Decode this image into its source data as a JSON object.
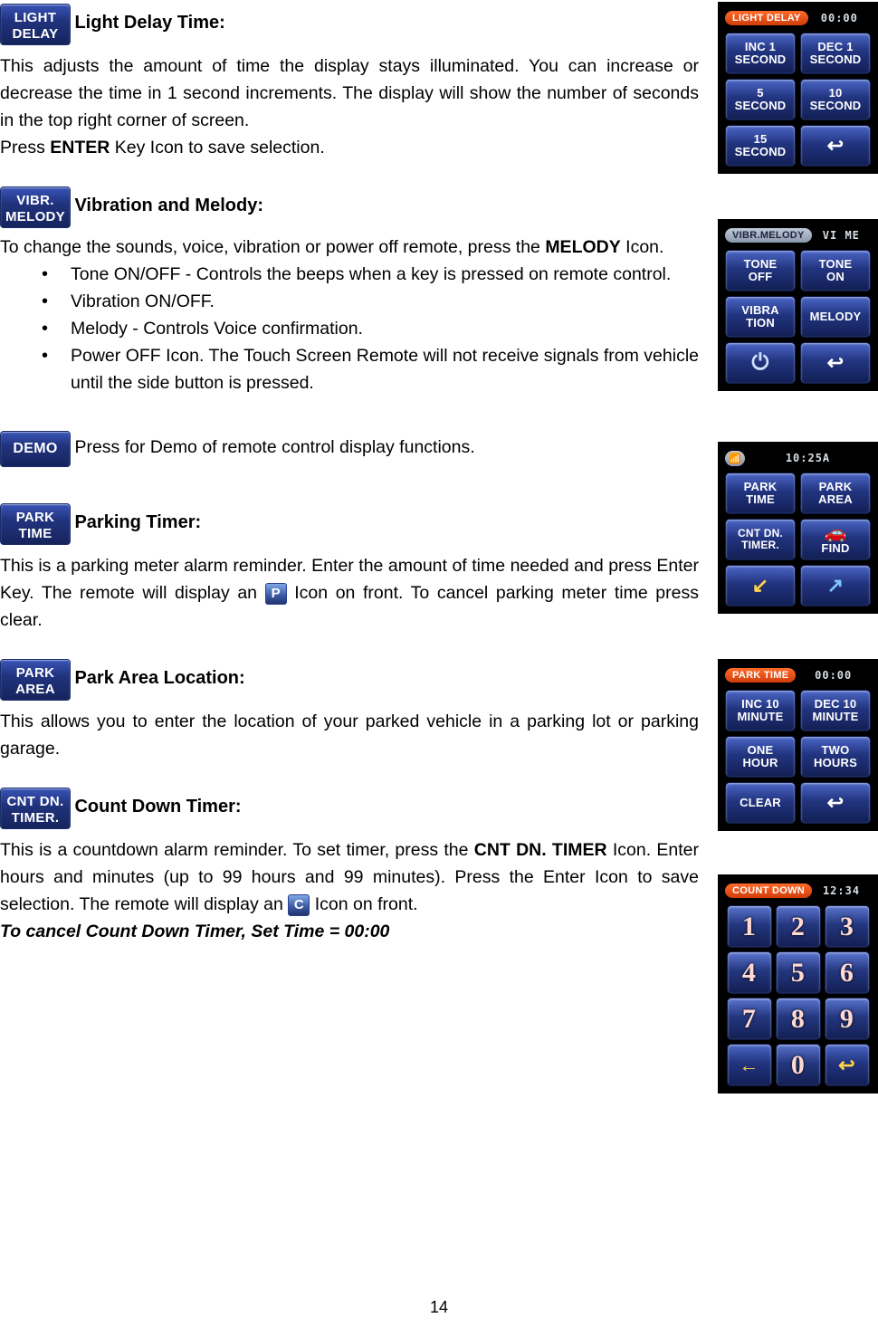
{
  "page": {
    "number": "14"
  },
  "sections": [
    {
      "id": "light-delay",
      "icon": {
        "line1": "LIGHT",
        "line2": "DELAY"
      },
      "heading": "Light Delay Time:",
      "paragraphs": [
        "This adjusts the amount of time the display stays illuminated. You can increase or decrease the time in 1 second increments. The display will show the number of seconds in the top right corner of screen.",
        "Press ENTER Key Icon to save selection."
      ]
    },
    {
      "id": "vibration-melody",
      "icon": {
        "line1": "VIBR.",
        "line2": "MELODY"
      },
      "heading": "Vibration and Melody:",
      "paragraph": "To change the sounds, voice, vibration or power off remote, press the MELODY Icon.",
      "bullets": [
        "Tone ON/OFF - Controls the beeps when a key is pressed on remote control.",
        "Vibration ON/OFF.",
        "Melody - Controls Voice confirmation.",
        "Power OFF Icon. The Touch Screen Remote will not receive signals from vehicle until the side button is pressed."
      ]
    },
    {
      "id": "demo",
      "icon": {
        "line1": "DEMO",
        "line2": ""
      },
      "text": "Press for Demo of remote control display functions."
    },
    {
      "id": "parking-timer",
      "icon": {
        "line1": "PARK",
        "line2": "TIME"
      },
      "heading": "Parking Timer:",
      "text_before_icon": "This is a parking meter alarm reminder. Enter the amount of time needed and press Enter Key. The remote will display an",
      "inline_icon": "P",
      "text_after_icon": "Icon on front. To cancel parking meter time press clear."
    },
    {
      "id": "park-area",
      "icon": {
        "line1": "PARK",
        "line2": "AREA"
      },
      "heading": "Park Area Location:",
      "text": "This allows you to enter the location of your parked vehicle in a parking lot or parking garage."
    },
    {
      "id": "count-down-timer",
      "icon": {
        "line1": "CNT DN.",
        "line2": "TIMER."
      },
      "heading": "Count Down Timer:",
      "text_before_icon": "This is a countdown alarm reminder. To set timer, press the CNT DN. TIMER Icon. Enter hours and minutes (up to 99 hours and 99 minutes). Press the Enter Icon to save selection. The remote will display an",
      "inline_icon": "C",
      "text_after_icon": "Icon on front.",
      "note": "To cancel Count Down Timer, Set Time = 00:00"
    }
  ],
  "devices": [
    {
      "id": "light-delay-screen",
      "title": "LIGHT DELAY",
      "value": "00:00",
      "buttons": [
        {
          "line1": "INC 1",
          "line2": "SECOND"
        },
        {
          "line1": "DEC 1",
          "line2": "SECOND"
        },
        {
          "line1": "5",
          "line2": "SECOND"
        },
        {
          "line1": "10",
          "line2": "SECOND"
        },
        {
          "line1": "15",
          "line2": "SECOND"
        },
        {
          "line1": "↩",
          "line2": "",
          "type": "arrow"
        }
      ]
    },
    {
      "id": "vibr-melody-screen",
      "title": "VIBR.MELODY",
      "value": "VI ME",
      "buttons": [
        {
          "line1": "TONE",
          "line2": "OFF"
        },
        {
          "line1": "TONE",
          "line2": "ON"
        },
        {
          "line1": "VIBRA",
          "line2": "TION"
        },
        {
          "line1": "MELODY",
          "line2": ""
        },
        {
          "line1": "⏻",
          "line2": "",
          "type": "power"
        },
        {
          "line1": "↩",
          "line2": "",
          "type": "arrow"
        }
      ]
    },
    {
      "id": "main-menu-screen",
      "title": "",
      "value": "10:25A",
      "buttons": [
        {
          "line1": "PARK",
          "line2": "TIME"
        },
        {
          "line1": "PARK",
          "line2": "AREA"
        },
        {
          "line1": "CNT DN.",
          "line2": "TIMER."
        },
        {
          "line1": "FIND",
          "line2": "",
          "type": "find"
        },
        {
          "line1": "↙",
          "line2": "",
          "type": "arrow-yellow"
        },
        {
          "line1": "↗",
          "line2": "",
          "type": "arrow-blue"
        }
      ]
    },
    {
      "id": "park-time-screen",
      "title": "PARK TIME",
      "value": "00:00",
      "buttons": [
        {
          "line1": "INC 10",
          "line2": "MINUTE"
        },
        {
          "line1": "DEC 10",
          "line2": "MINUTE"
        },
        {
          "line1": "ONE",
          "line2": "HOUR"
        },
        {
          "line1": "TWO",
          "line2": "HOURS"
        },
        {
          "line1": "CLEAR",
          "line2": ""
        },
        {
          "line1": "↩",
          "line2": "",
          "type": "arrow"
        }
      ]
    },
    {
      "id": "count-down-screen",
      "title": "COUNT DOWN",
      "value": "12:34",
      "buttons": [
        {
          "line1": "1",
          "line2": "",
          "type": "num"
        },
        {
          "line1": "2",
          "line2": "",
          "type": "num"
        },
        {
          "line1": "3",
          "line2": "",
          "type": "num"
        },
        {
          "line1": "4",
          "line2": "",
          "type": "num"
        },
        {
          "line1": "5",
          "line2": "",
          "type": "num"
        },
        {
          "line1": "6",
          "line2": "",
          "type": "num"
        },
        {
          "line1": "7",
          "line2": "",
          "type": "num"
        },
        {
          "line1": "8",
          "line2": "",
          "type": "num"
        },
        {
          "line1": "9",
          "line2": "",
          "type": "num"
        },
        {
          "line1": "←",
          "line2": "",
          "type": "arrow"
        },
        {
          "line1": "0",
          "line2": "",
          "type": "num"
        },
        {
          "line1": "↩",
          "line2": "",
          "type": "arrow"
        }
      ]
    }
  ]
}
